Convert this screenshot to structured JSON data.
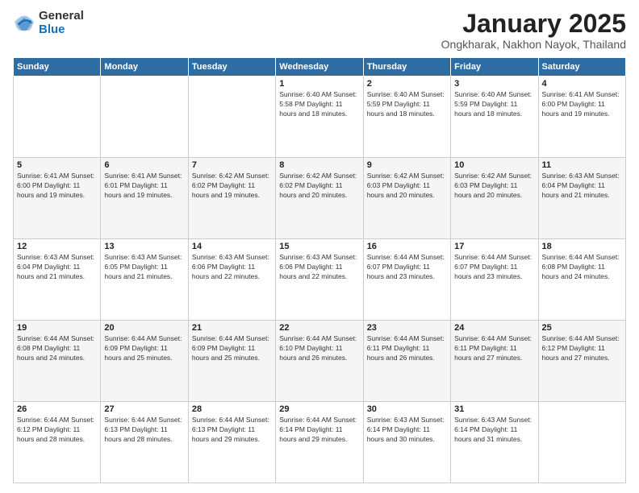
{
  "logo": {
    "general": "General",
    "blue": "Blue"
  },
  "header": {
    "month": "January 2025",
    "location": "Ongkharak, Nakhon Nayok, Thailand"
  },
  "weekdays": [
    "Sunday",
    "Monday",
    "Tuesday",
    "Wednesday",
    "Thursday",
    "Friday",
    "Saturday"
  ],
  "weeks": [
    [
      {
        "day": "",
        "info": ""
      },
      {
        "day": "",
        "info": ""
      },
      {
        "day": "",
        "info": ""
      },
      {
        "day": "1",
        "info": "Sunrise: 6:40 AM\nSunset: 5:58 PM\nDaylight: 11 hours and 18 minutes."
      },
      {
        "day": "2",
        "info": "Sunrise: 6:40 AM\nSunset: 5:59 PM\nDaylight: 11 hours and 18 minutes."
      },
      {
        "day": "3",
        "info": "Sunrise: 6:40 AM\nSunset: 5:59 PM\nDaylight: 11 hours and 18 minutes."
      },
      {
        "day": "4",
        "info": "Sunrise: 6:41 AM\nSunset: 6:00 PM\nDaylight: 11 hours and 19 minutes."
      }
    ],
    [
      {
        "day": "5",
        "info": "Sunrise: 6:41 AM\nSunset: 6:00 PM\nDaylight: 11 hours and 19 minutes."
      },
      {
        "day": "6",
        "info": "Sunrise: 6:41 AM\nSunset: 6:01 PM\nDaylight: 11 hours and 19 minutes."
      },
      {
        "day": "7",
        "info": "Sunrise: 6:42 AM\nSunset: 6:02 PM\nDaylight: 11 hours and 19 minutes."
      },
      {
        "day": "8",
        "info": "Sunrise: 6:42 AM\nSunset: 6:02 PM\nDaylight: 11 hours and 20 minutes."
      },
      {
        "day": "9",
        "info": "Sunrise: 6:42 AM\nSunset: 6:03 PM\nDaylight: 11 hours and 20 minutes."
      },
      {
        "day": "10",
        "info": "Sunrise: 6:42 AM\nSunset: 6:03 PM\nDaylight: 11 hours and 20 minutes."
      },
      {
        "day": "11",
        "info": "Sunrise: 6:43 AM\nSunset: 6:04 PM\nDaylight: 11 hours and 21 minutes."
      }
    ],
    [
      {
        "day": "12",
        "info": "Sunrise: 6:43 AM\nSunset: 6:04 PM\nDaylight: 11 hours and 21 minutes."
      },
      {
        "day": "13",
        "info": "Sunrise: 6:43 AM\nSunset: 6:05 PM\nDaylight: 11 hours and 21 minutes."
      },
      {
        "day": "14",
        "info": "Sunrise: 6:43 AM\nSunset: 6:06 PM\nDaylight: 11 hours and 22 minutes."
      },
      {
        "day": "15",
        "info": "Sunrise: 6:43 AM\nSunset: 6:06 PM\nDaylight: 11 hours and 22 minutes."
      },
      {
        "day": "16",
        "info": "Sunrise: 6:44 AM\nSunset: 6:07 PM\nDaylight: 11 hours and 23 minutes."
      },
      {
        "day": "17",
        "info": "Sunrise: 6:44 AM\nSunset: 6:07 PM\nDaylight: 11 hours and 23 minutes."
      },
      {
        "day": "18",
        "info": "Sunrise: 6:44 AM\nSunset: 6:08 PM\nDaylight: 11 hours and 24 minutes."
      }
    ],
    [
      {
        "day": "19",
        "info": "Sunrise: 6:44 AM\nSunset: 6:08 PM\nDaylight: 11 hours and 24 minutes."
      },
      {
        "day": "20",
        "info": "Sunrise: 6:44 AM\nSunset: 6:09 PM\nDaylight: 11 hours and 25 minutes."
      },
      {
        "day": "21",
        "info": "Sunrise: 6:44 AM\nSunset: 6:09 PM\nDaylight: 11 hours and 25 minutes."
      },
      {
        "day": "22",
        "info": "Sunrise: 6:44 AM\nSunset: 6:10 PM\nDaylight: 11 hours and 26 minutes."
      },
      {
        "day": "23",
        "info": "Sunrise: 6:44 AM\nSunset: 6:11 PM\nDaylight: 11 hours and 26 minutes."
      },
      {
        "day": "24",
        "info": "Sunrise: 6:44 AM\nSunset: 6:11 PM\nDaylight: 11 hours and 27 minutes."
      },
      {
        "day": "25",
        "info": "Sunrise: 6:44 AM\nSunset: 6:12 PM\nDaylight: 11 hours and 27 minutes."
      }
    ],
    [
      {
        "day": "26",
        "info": "Sunrise: 6:44 AM\nSunset: 6:12 PM\nDaylight: 11 hours and 28 minutes."
      },
      {
        "day": "27",
        "info": "Sunrise: 6:44 AM\nSunset: 6:13 PM\nDaylight: 11 hours and 28 minutes."
      },
      {
        "day": "28",
        "info": "Sunrise: 6:44 AM\nSunset: 6:13 PM\nDaylight: 11 hours and 29 minutes."
      },
      {
        "day": "29",
        "info": "Sunrise: 6:44 AM\nSunset: 6:14 PM\nDaylight: 11 hours and 29 minutes."
      },
      {
        "day": "30",
        "info": "Sunrise: 6:43 AM\nSunset: 6:14 PM\nDaylight: 11 hours and 30 minutes."
      },
      {
        "day": "31",
        "info": "Sunrise: 6:43 AM\nSunset: 6:14 PM\nDaylight: 11 hours and 31 minutes."
      },
      {
        "day": "",
        "info": ""
      }
    ]
  ]
}
